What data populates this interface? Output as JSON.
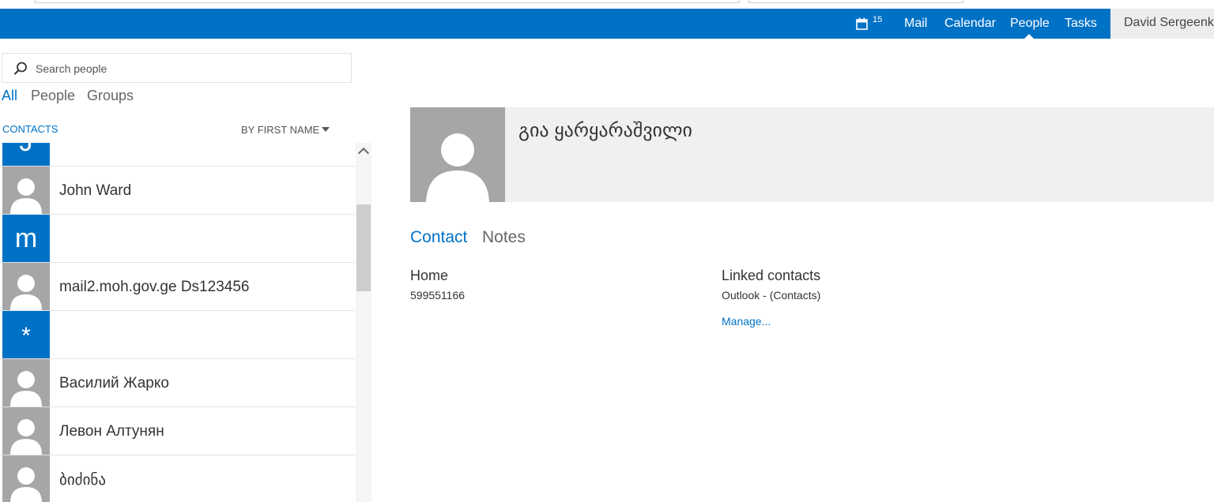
{
  "nav": {
    "calendar_count": "15",
    "links": [
      "Mail",
      "Calendar",
      "People",
      "Tasks"
    ],
    "active": "People",
    "user_name": "David Sergeenko"
  },
  "search": {
    "placeholder": "Search people"
  },
  "filters": {
    "all": "All",
    "people": "People",
    "groups": "Groups"
  },
  "list_header": {
    "contacts": "CONTACTS",
    "sort": "BY FIRST NAME"
  },
  "contacts": [
    {
      "tile": "J",
      "name": ""
    },
    {
      "tile": "avatar",
      "name": "John Ward"
    },
    {
      "tile": "m",
      "name": ""
    },
    {
      "tile": "avatar",
      "name": "mail2.moh.gov.ge Ds123456"
    },
    {
      "tile": "*",
      "name": ""
    },
    {
      "tile": "avatar",
      "name": "Василий Жарко"
    },
    {
      "tile": "avatar",
      "name": "Левон Алтунян"
    },
    {
      "tile": "avatar",
      "name": "ბიძინა"
    }
  ],
  "detail": {
    "name": "გია ყარყარაშვილი",
    "tabs": {
      "contact": "Contact",
      "notes": "Notes"
    },
    "home_label": "Home",
    "home_value": "599551166",
    "linked_label": "Linked contacts",
    "linked_value": "Outlook - (Contacts)",
    "manage": "Manage..."
  },
  "colors": {
    "accent": "#0072c6",
    "avatar_gray": "#a6a6a6"
  }
}
